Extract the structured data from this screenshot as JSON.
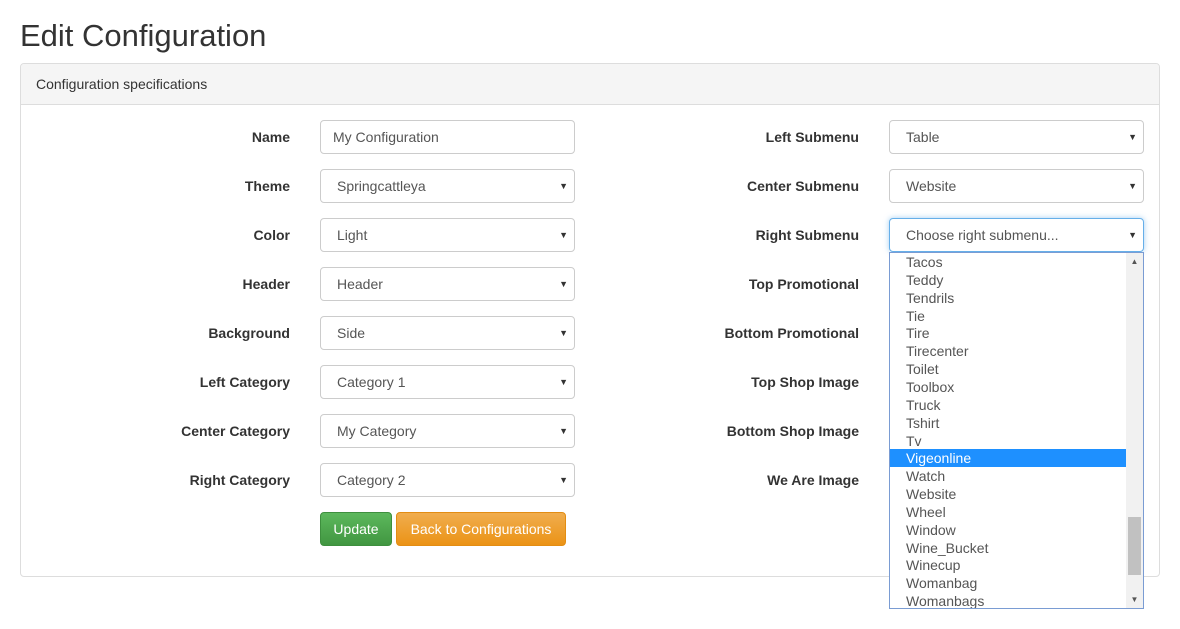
{
  "page": {
    "title": "Edit Configuration"
  },
  "panel": {
    "heading": "Configuration specifications"
  },
  "left_fields": [
    {
      "label": "Name",
      "value": "My Configuration",
      "kind": "input"
    },
    {
      "label": "Theme",
      "value": "Springcattleya",
      "kind": "select"
    },
    {
      "label": "Color",
      "value": "Light",
      "kind": "select"
    },
    {
      "label": "Header",
      "value": "Header",
      "kind": "select"
    },
    {
      "label": "Background",
      "value": "Side",
      "kind": "select"
    },
    {
      "label": "Left Category",
      "value": "Category 1",
      "kind": "select"
    },
    {
      "label": "Center Category",
      "value": "My Category",
      "kind": "select"
    },
    {
      "label": "Right Category",
      "value": "Category 2",
      "kind": "select"
    }
  ],
  "right_fields": [
    {
      "label": "Left Submenu",
      "value": "Table"
    },
    {
      "label": "Center Submenu",
      "value": "Website"
    },
    {
      "label": "Right Submenu",
      "value": "Choose right submenu..."
    },
    {
      "label": "Top Promotional"
    },
    {
      "label": "Bottom Promotional"
    },
    {
      "label": "Top Shop Image"
    },
    {
      "label": "Bottom Shop Image"
    },
    {
      "label": "We Are Image"
    }
  ],
  "buttons": {
    "update": "Update",
    "back": "Back to Configurations"
  },
  "icons": {
    "caret": "caret-down-icon",
    "scroll_up": "scroll-up-icon",
    "scroll_down": "scroll-down-icon"
  },
  "dropdown": {
    "options": [
      "Tacos",
      "Teddy",
      "Tendrils",
      "Tie",
      "Tire",
      "Tirecenter",
      "Toilet",
      "Toolbox",
      "Truck",
      "Tshirt",
      "Tv",
      "Vigeonline",
      "Watch",
      "Website",
      "Wheel",
      "Window",
      "Wine_Bucket",
      "Winecup",
      "Womanbag",
      "Womanbags"
    ],
    "highlighted": "Vigeonline",
    "scroll_fraction_top": 0.77,
    "scroll_fraction_size": 0.18
  },
  "colors": {
    "update_button": "#5cb85c",
    "back_button": "#f0ad4e",
    "highlight": "#1e90ff",
    "focus_border": "#66afe9"
  }
}
